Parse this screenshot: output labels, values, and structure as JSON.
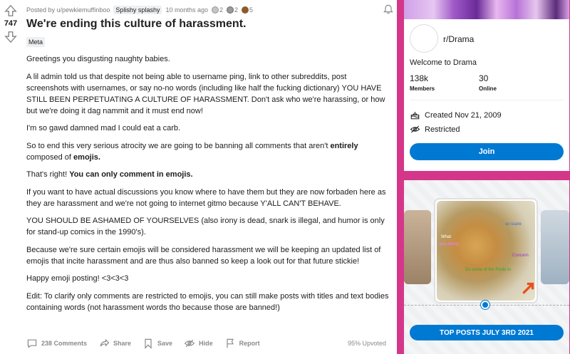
{
  "post": {
    "score": "747",
    "posted_by": "Posted by u/pewkiemuffinboo",
    "user_flair": "Splishy splashy",
    "time": "10 months ago",
    "awards": [
      {
        "icon": "award-helpful-icon",
        "count": "2",
        "color": "#b8b8b8"
      },
      {
        "icon": "award-wholesome-icon",
        "count": "2",
        "color": "#8a8a8a"
      },
      {
        "icon": "award-bear-icon",
        "count": "5",
        "color": "#8c5a2b"
      }
    ],
    "title": "We're ending this culture of harassment.",
    "flair": "Meta",
    "body": {
      "p1": "Greetings you disgusting naughty babies.",
      "p2": "A lil admin told us that despite not being able to username ping, link to other subreddits, post screenshots with usernames, or say no-no words (including like half the fucking dictionary) YOU HAVE STILL BEEN PERPETUATING A CULTURE OF HARASSMENT. Don't ask who we're harassing, or how but we're doing it dag nammit and it must end now!",
      "p3": "I'm so gawd damned mad I could eat a carb.",
      "p4_a": "So to end this very serious atrocity we are going to be banning all comments that aren't ",
      "p4_b": "entirely",
      "p4_c": " composed of ",
      "p4_d": "emojis.",
      "p5_a": "That's right! ",
      "p5_b": "You can only comment in emojis.",
      "p6": "If you want to have actual discussions you know where to have them but they are now forbaden here as they are harassment and we're not going to internet gitmo because Y'ALL CAN'T BEHAVE.",
      "p7": "YOU SHOULD BE ASHAMED OF YOURSELVES (also irony is dead, snark is illegal, and humor is only for stand-up comics in the 1990's).",
      "p8": "Because we're sure certain emojis will be considered harassment we will be keeping an updated list of emojis that incite harassment and are thus also banned so keep a look out for that future stickie!",
      "p9": "Happy emoji posting! <3<3<3",
      "p10": "Edit: To clarify only comments are restricted to emojis, you can still make posts with titles and text bodies containing words (not harassment words tho because those are banned!)"
    },
    "actions": {
      "comments": "238 Comments",
      "share": "Share",
      "save": "Save",
      "hide": "Hide",
      "report": "Report",
      "upvoted": "95% Upvoted"
    }
  },
  "community": {
    "name": "r/Drama",
    "welcome": "Welcome to Drama",
    "members_value": "138k",
    "members_label": "Members",
    "online_value": "30",
    "online_label": "Online",
    "created": "Created Nov 21, 2009",
    "restricted": "Restricted",
    "join_label": "Join"
  },
  "top_posts": {
    "button_label": "TOP POSTS JULY 3RD 2021",
    "meme_texts": [
      "What",
      "you doing",
      "so scare",
      "Concern",
      "Do some of the Posts to"
    ]
  },
  "colors": {
    "page_bg": "#d4378a",
    "accent": "#0079d3"
  }
}
